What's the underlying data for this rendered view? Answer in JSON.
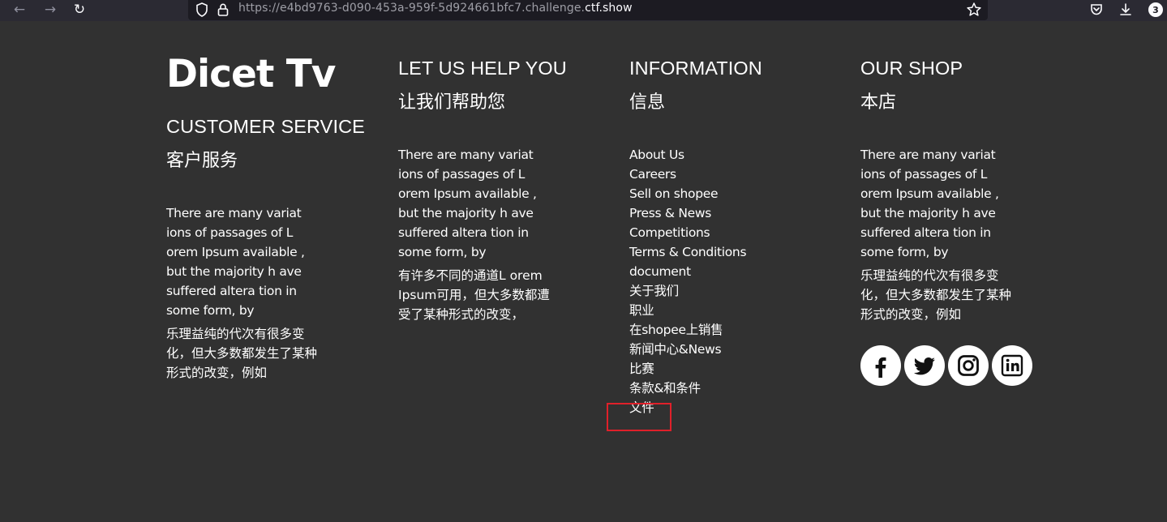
{
  "browser": {
    "url_prefix": "https://e4bd9763-d090-453a-959f-5d924661bfc7.challenge.",
    "url_host": "ctf.show",
    "downloads_badge": "3",
    "icons": [
      "back-icon",
      "forward-icon",
      "reload-icon",
      "shield-icon",
      "lock-icon",
      "bookmark-star-icon",
      "pocket-icon",
      "download-icon"
    ]
  },
  "footer": {
    "brand": "Dicet Tv",
    "customer_service": {
      "heading": "CUSTOMER SERVICE",
      "heading_cn": "客户服务",
      "body": "There are many variat ions of passages of L orem Ipsum available , but the majority h ave suffered altera tion in some form, by",
      "body_cn": "乐理益纯的代次有很多变化，但大多数都发生了某种形式的改变，例如"
    },
    "help": {
      "heading": "LET US HELP YOU",
      "heading_cn": "让我们帮助您",
      "body": "There are many variat ions of passages of L orem Ipsum available , but the majority h ave suffered altera tion in some form, by",
      "body_cn": "有许多不同的通道L orem Ipsum可用，但大多数都遭受了某种形式的改变，"
    },
    "information": {
      "heading": "INFORMATION",
      "heading_cn": "信息",
      "links": [
        "About Us",
        "Careers",
        "Sell on shopee",
        "Press & News",
        "Competitions",
        "Terms & Conditions",
        "document",
        "关于我们",
        "职业",
        "在shopee上销售",
        "新闻中心&News",
        "比赛",
        "条款&和条件",
        "文件"
      ]
    },
    "shop": {
      "heading": "OUR SHOP",
      "heading_cn": "本店",
      "body": "There are many variat ions of passages of L orem Ipsum available , but the majority h ave suffered altera tion in some form, by",
      "body_cn": "乐理益纯的代次有很多变化，但大多数都发生了某种形式的改变，例如",
      "social": [
        "facebook-icon",
        "twitter-icon",
        "instagram-icon",
        "linkedin-icon"
      ]
    }
  },
  "colors": {
    "background": "#313131",
    "text": "#ffffff",
    "highlight": "#e0202a"
  }
}
